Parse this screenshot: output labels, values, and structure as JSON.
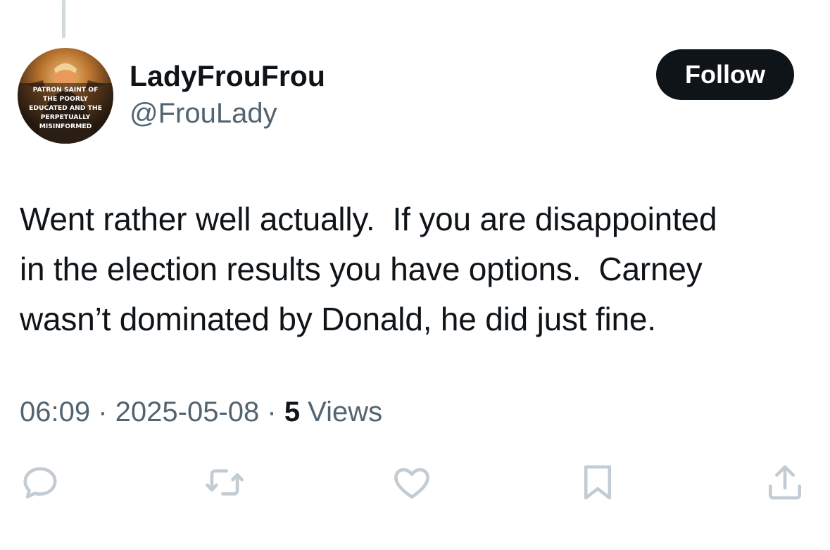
{
  "author": {
    "display_name": "LadyFrouFrou",
    "handle": "@FrouLady",
    "avatar_text": [
      "PATRON SAINT OF",
      "THE POORLY",
      "EDUCATED AND THE",
      "PERPETUALLY",
      "MISINFORMED"
    ]
  },
  "follow_label": "Follow",
  "tweet": {
    "text": "Went rather well actually.  If you are disappointed\nin the election results you have options.  Carney\nwasn’t dominated by Donald, he did just fine."
  },
  "meta": {
    "time": "06:09",
    "separator": " · ",
    "date": "2025-05-08",
    "views_count": "5",
    "views_label": " Views"
  },
  "actions": [
    "reply-icon",
    "retweet-icon",
    "like-icon",
    "bookmark-icon",
    "share-icon"
  ],
  "colors": {
    "text_primary": "#0f1419",
    "text_secondary": "#536471",
    "icon": "#c4ccd3",
    "thread_line": "#cfd9de",
    "button_bg": "#0f1419"
  }
}
